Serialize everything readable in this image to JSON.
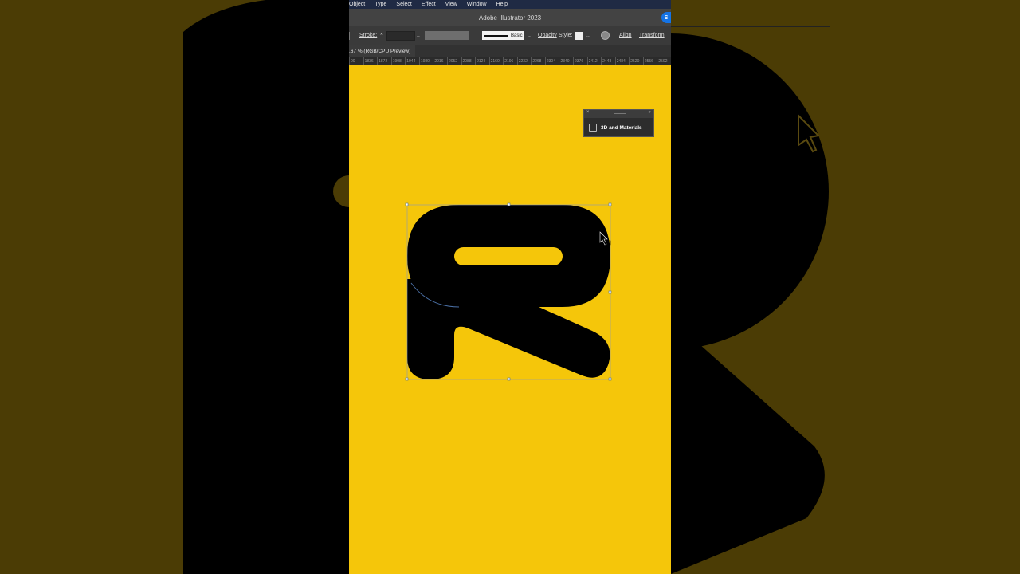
{
  "menu": [
    "Object",
    "Type",
    "Select",
    "Effect",
    "View",
    "Window",
    "Help"
  ],
  "app_title": "Adobe Illustrator 2023",
  "share_label": "S",
  "control": {
    "stroke_label": "Stroke:",
    "brush_label": "Basic",
    "opacity_label": "Opacity",
    "style_label": "Style:",
    "align_label": "Align",
    "transform_label": "Transform"
  },
  "doc_tab": ".67 % (RGB/CPU Preview)",
  "ruler_ticks": [
    "00",
    "1836",
    "1872",
    "1908",
    "1944",
    "1980",
    "2016",
    "2052",
    "2088",
    "2124",
    "2160",
    "2196",
    "2232",
    "2268",
    "2304",
    "2340",
    "2376",
    "2412",
    "2448",
    "2484",
    "2520",
    "2556",
    "2592"
  ],
  "panel": {
    "title": "3D and Materials"
  },
  "colors": {
    "canvas": "#f5c60a",
    "artwork": "#000000",
    "selection": "#4a6fa5"
  }
}
